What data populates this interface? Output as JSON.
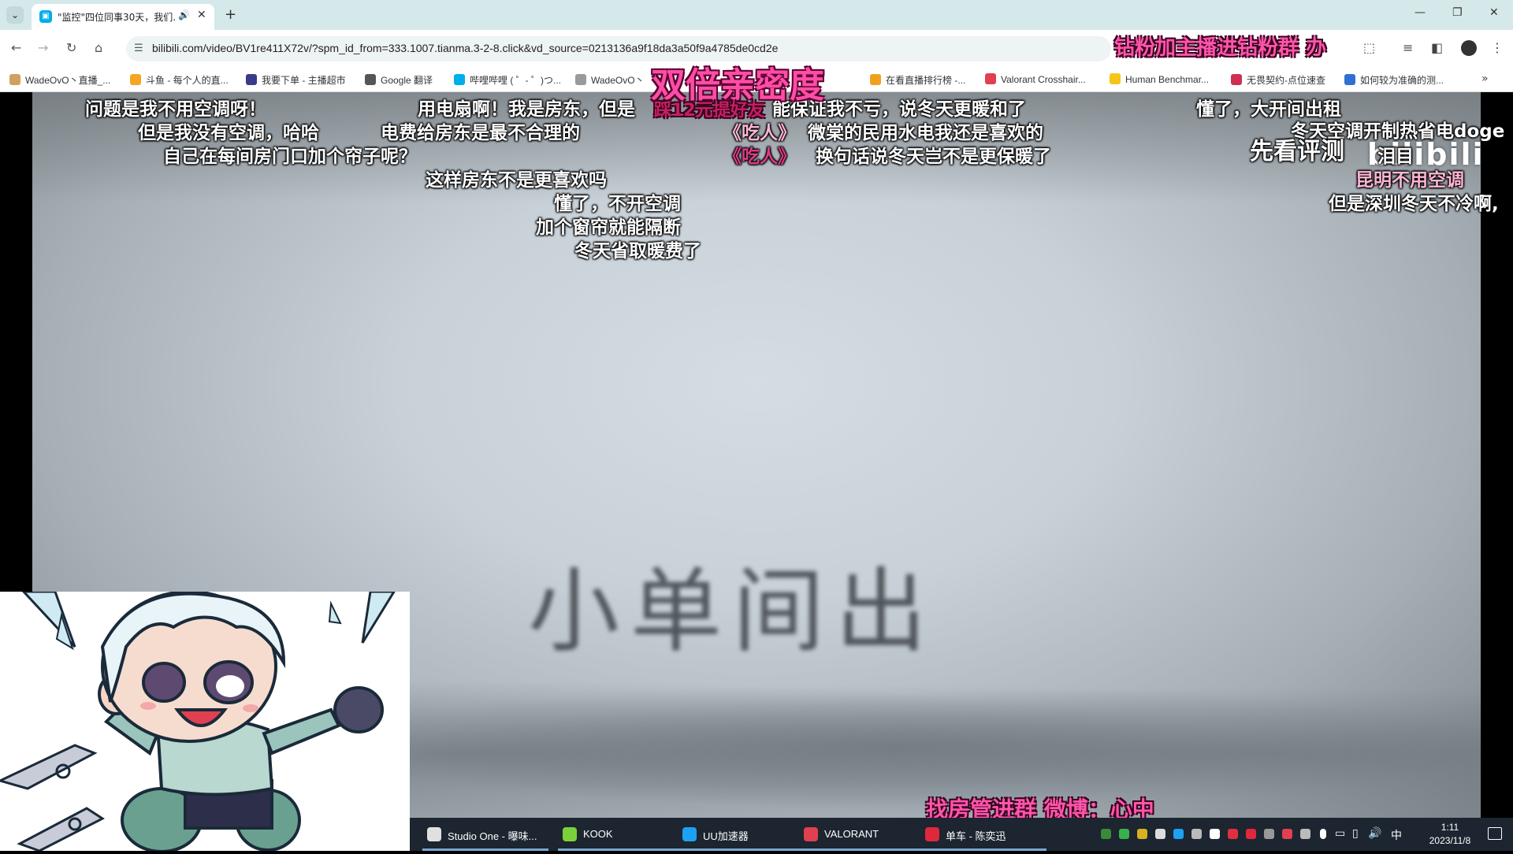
{
  "browser": {
    "tab": {
      "title": "\"监控\"四位同事30天，我们…",
      "close": "✕",
      "audio": "🔊"
    },
    "new_tab": "+",
    "window": {
      "minimize": "—",
      "restore": "❐",
      "close": "✕"
    },
    "url": "bilibili.com/video/BV1re411X72v/?spm_id_from=333.1007.tianma.3-2-8.click&vd_source=0213136a9f18da3a50f9a4785de0cd2e",
    "bookmarks": [
      {
        "label": "WadeOvO丶直播_...",
        "color": "#d0a060"
      },
      {
        "label": "斗鱼 - 每个人的直...",
        "color": "#f5a623"
      },
      {
        "label": "我要下单 - 主播超市",
        "color": "#3a3a8a"
      },
      {
        "label": "Google 翻译",
        "color": "#555555"
      },
      {
        "label": "哔哩哔哩 ( ゜- ゜)つ...",
        "color": "#00aeec"
      },
      {
        "label": "WadeOvO丶",
        "color": "#9a9a9a"
      },
      {
        "label": "在看直播排行榜 -...",
        "color": "#f0a020"
      },
      {
        "label": "Valorant Crosshair...",
        "color": "#e04050"
      },
      {
        "label": "Human Benchmar...",
        "color": "#f5c518"
      },
      {
        "label": "无畏契约-点位速查",
        "color": "#d03050"
      },
      {
        "label": "如何较为准确的测...",
        "color": "#3070d0"
      }
    ]
  },
  "video": {
    "caption": "小单间出",
    "bili_logo": "bilibili",
    "danmaku": [
      {
        "text": "问题是我不用空调呀！",
        "color": "white"
      },
      {
        "text": "但是我没有空调，哈哈",
        "color": "white"
      },
      {
        "text": "自己在每间房门口加个帘子呢？",
        "color": "white"
      },
      {
        "text": "用电扇啊！",
        "color": "white"
      },
      {
        "text": "电费给房东是最不合理的",
        "color": "white"
      },
      {
        "text": "这样房东不是更喜欢吗",
        "color": "white"
      },
      {
        "text": "懂了，不开空调",
        "color": "white"
      },
      {
        "text": "加个窗帘就能隔断",
        "color": "white"
      },
      {
        "text": "冬天省取暖费了",
        "color": "white"
      },
      {
        "text": "我是房东，但是",
        "color": "white"
      },
      {
        "text": "能保证我不亏，说冬天更暖和了",
        "color": "white"
      },
      {
        "text": "《吃人》",
        "color": "pink"
      },
      {
        "text": "《吃人》",
        "color": "magenta"
      },
      {
        "text": "微棠的民用水电我还是喜欢的",
        "color": "white"
      },
      {
        "text": "换句话说冬天岂不是更保暖了",
        "color": "white"
      },
      {
        "text": "懂了，大开间出租",
        "color": "white"
      },
      {
        "text": "冬天空调开制热省电doge",
        "color": "white"
      },
      {
        "text": "先看评测",
        "color": "white"
      },
      {
        "text": "泪目",
        "color": "white"
      },
      {
        "text": "昆明不用空调",
        "color": "pink"
      },
      {
        "text": "但是深圳冬天不冷啊,",
        "color": "white"
      }
    ]
  },
  "stream_overlay": {
    "double_intimacy": "双倍亲密度",
    "top_banner": "钻粉加主播进钻粉群  办",
    "bottom_banner": "找房管进群  微博：心中",
    "small_overlay": "踩12元提好友"
  },
  "taskbar": {
    "apps": [
      {
        "label": "Studio One - 曝味...",
        "color": "#e0e0e0"
      },
      {
        "label": "KOOK",
        "color": "#7cd13a"
      },
      {
        "label": "UU加速器",
        "color": "#1da1f2"
      },
      {
        "label": "VALORANT",
        "color": "#e04050"
      },
      {
        "label": "单车 - 陈奕迅",
        "color": "#e0283c"
      }
    ],
    "ime": "中",
    "time": "1:11",
    "date": "2023/11/8"
  }
}
